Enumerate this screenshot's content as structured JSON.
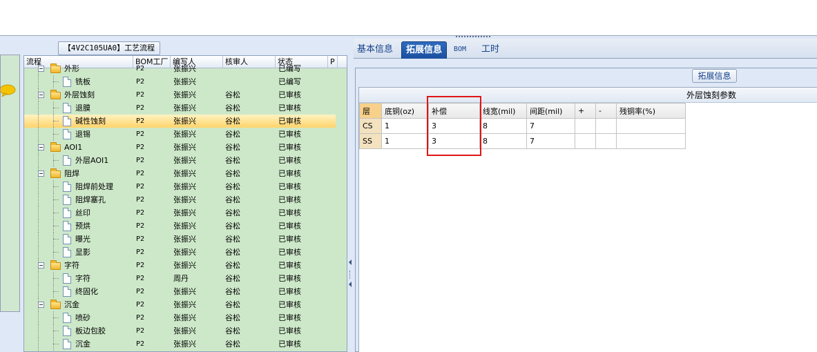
{
  "process_panel": {
    "title": "【4V2C105UA0】工艺流程",
    "columns": [
      "流程",
      "BOM工厂",
      "编写人",
      "核审人",
      "状态",
      "P"
    ],
    "rows": [
      {
        "indent": 1,
        "kind": "folder",
        "name": "外形",
        "bom": "P2",
        "writer": "张振兴",
        "reviewer": "",
        "status": "已编写",
        "partial": true
      },
      {
        "indent": 2,
        "kind": "doc",
        "name": "铣板",
        "bom": "P2",
        "writer": "张振兴",
        "reviewer": "",
        "status": "已编写"
      },
      {
        "indent": 1,
        "kind": "folder",
        "name": "外层蚀刻",
        "bom": "P2",
        "writer": "张振兴",
        "reviewer": "谷松",
        "status": "已审核"
      },
      {
        "indent": 2,
        "kind": "doc",
        "name": "退膜",
        "bom": "P2",
        "writer": "张振兴",
        "reviewer": "谷松",
        "status": "已审核"
      },
      {
        "indent": 2,
        "kind": "doc",
        "name": "碱性蚀刻",
        "bom": "P2",
        "writer": "张振兴",
        "reviewer": "谷松",
        "status": "已审核",
        "selected": true
      },
      {
        "indent": 2,
        "kind": "doc",
        "name": "退锡",
        "bom": "P2",
        "writer": "张振兴",
        "reviewer": "谷松",
        "status": "已审核"
      },
      {
        "indent": 1,
        "kind": "folder",
        "name": "AOI1",
        "bom": "P2",
        "writer": "张振兴",
        "reviewer": "谷松",
        "status": "已审核"
      },
      {
        "indent": 2,
        "kind": "doc",
        "name": "外层AOI1",
        "bom": "P2",
        "writer": "张振兴",
        "reviewer": "谷松",
        "status": "已审核"
      },
      {
        "indent": 1,
        "kind": "folder",
        "name": "阻焊",
        "bom": "P2",
        "writer": "张振兴",
        "reviewer": "谷松",
        "status": "已审核"
      },
      {
        "indent": 2,
        "kind": "doc",
        "name": "阻焊前处理",
        "bom": "P2",
        "writer": "张振兴",
        "reviewer": "谷松",
        "status": "已审核"
      },
      {
        "indent": 2,
        "kind": "doc",
        "name": "阻焊塞孔",
        "bom": "P2",
        "writer": "张振兴",
        "reviewer": "谷松",
        "status": "已审核"
      },
      {
        "indent": 2,
        "kind": "doc",
        "name": "丝印",
        "bom": "P2",
        "writer": "张振兴",
        "reviewer": "谷松",
        "status": "已审核"
      },
      {
        "indent": 2,
        "kind": "doc",
        "name": "预烘",
        "bom": "P2",
        "writer": "张振兴",
        "reviewer": "谷松",
        "status": "已审核"
      },
      {
        "indent": 2,
        "kind": "doc",
        "name": "曝光",
        "bom": "P2",
        "writer": "张振兴",
        "reviewer": "谷松",
        "status": "已审核"
      },
      {
        "indent": 2,
        "kind": "doc",
        "name": "显影",
        "bom": "P2",
        "writer": "张振兴",
        "reviewer": "谷松",
        "status": "已审核"
      },
      {
        "indent": 1,
        "kind": "folder",
        "name": "字符",
        "bom": "P2",
        "writer": "张振兴",
        "reviewer": "谷松",
        "status": "已审核"
      },
      {
        "indent": 2,
        "kind": "doc",
        "name": "字符",
        "bom": "P2",
        "writer": "周丹",
        "reviewer": "谷松",
        "status": "已审核"
      },
      {
        "indent": 2,
        "kind": "doc",
        "name": "终固化",
        "bom": "P2",
        "writer": "张振兴",
        "reviewer": "谷松",
        "status": "已审核"
      },
      {
        "indent": 1,
        "kind": "folder",
        "name": "沉金",
        "bom": "P2",
        "writer": "张振兴",
        "reviewer": "谷松",
        "status": "已审核"
      },
      {
        "indent": 2,
        "kind": "doc",
        "name": "喷砂",
        "bom": "P2",
        "writer": "张振兴",
        "reviewer": "谷松",
        "status": "已审核"
      },
      {
        "indent": 2,
        "kind": "doc",
        "name": "板边包胶",
        "bom": "P2",
        "writer": "张振兴",
        "reviewer": "谷松",
        "status": "已审核"
      },
      {
        "indent": 2,
        "kind": "doc",
        "name": "沉金",
        "bom": "P2",
        "writer": "张振兴",
        "reviewer": "谷松",
        "status": "已审核"
      }
    ]
  },
  "tabs": [
    {
      "label": "基本信息",
      "active": false
    },
    {
      "label": "拓展信息",
      "active": true
    },
    {
      "label": "BOM",
      "active": false
    },
    {
      "label": "工时",
      "active": false
    }
  ],
  "extended_info": {
    "legend": "拓展信息",
    "grid_title": "外层蚀刻参数",
    "columns": [
      "层",
      "底铜(oz)",
      "补偿",
      "线宽(mil)",
      "间距(mil)",
      "+",
      "-",
      "残铜率(%)"
    ],
    "rows": [
      [
        "CS",
        "1",
        "3",
        "8",
        "7",
        "",
        "",
        ""
      ],
      [
        "SS",
        "1",
        "3",
        "8",
        "7",
        "",
        "",
        ""
      ]
    ],
    "highlighted_column": "补偿",
    "highlight_color": "#e01414"
  }
}
